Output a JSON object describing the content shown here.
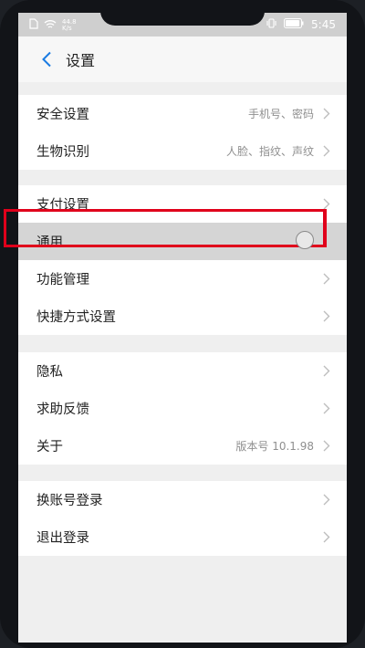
{
  "status_bar": {
    "network_speed": "44.8",
    "network_unit": "K/s",
    "time": "5:45"
  },
  "header": {
    "title": "设置"
  },
  "sections": [
    {
      "items": [
        {
          "label": "安全设置",
          "value": "手机号、密码"
        },
        {
          "label": "生物识别",
          "value": "人脸、指纹、声纹"
        }
      ]
    },
    {
      "items": [
        {
          "label": "支付设置",
          "value": ""
        },
        {
          "label": "通用",
          "value": ""
        },
        {
          "label": "功能管理",
          "value": ""
        },
        {
          "label": "快捷方式设置",
          "value": ""
        }
      ]
    },
    {
      "items": [
        {
          "label": "隐私",
          "value": ""
        },
        {
          "label": "求助反馈",
          "value": ""
        },
        {
          "label": "关于",
          "value": "版本号 10.1.98"
        }
      ]
    },
    {
      "items": [
        {
          "label": "换账号登录",
          "value": ""
        },
        {
          "label": "退出登录",
          "value": ""
        }
      ]
    }
  ],
  "colors": {
    "accent": "#1a7be2",
    "highlight_border": "#e0001b",
    "highlight_bg": "#d5d5d5"
  },
  "icons": {
    "back": "chevron-left-icon",
    "row_arrow": "chevron-right-icon"
  }
}
